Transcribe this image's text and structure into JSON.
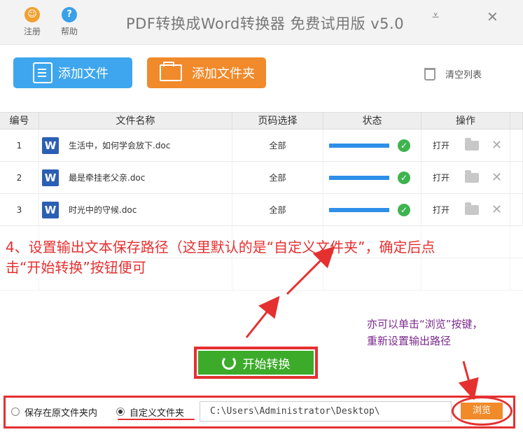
{
  "titlebar": {
    "register_label": "注册",
    "help_label": "帮助",
    "app_title": "PDF转换成Word转换器 免费试用版 v5.0",
    "minimize_glyph": "⩡",
    "close_glyph": "✕"
  },
  "toolbar": {
    "add_file_label": "添加文件",
    "add_folder_label": "添加文件夹",
    "clear_list_label": "清空列表"
  },
  "table": {
    "headers": [
      "编号",
      "文件名称",
      "页码选择",
      "状态",
      "操作"
    ],
    "rows": [
      {
        "no": "1",
        "name": "生活中，如何学会放下.doc",
        "pages": "全部",
        "progress": 1.0,
        "open": "打开"
      },
      {
        "no": "2",
        "name": "最是牵挂老父亲.doc",
        "pages": "全部",
        "progress": 1.0,
        "open": "打开"
      },
      {
        "no": "3",
        "name": "时光中的守候.doc",
        "pages": "全部",
        "progress": 1.0,
        "open": "打开"
      }
    ]
  },
  "annotations": {
    "main_line1": "4、设置输出文本保存路径（这里默认的是“自定义文件夹”，确定后点",
    "main_line2": "击“开始转换”按钮便可",
    "side_line1": "亦可以单击“浏览”按键，",
    "side_line2": "重新设置输出路径"
  },
  "start_button_label": "开始转换",
  "output": {
    "option_original": "保存在原文件夹内",
    "option_custom": "自定义文件夹",
    "selected": "custom",
    "path_value": "C:\\Users\\Administrator\\Desktop\\",
    "browse_label": "浏览"
  },
  "colors": {
    "add_file_button": "#3ea6ee",
    "add_folder_button": "#f08a2a",
    "start_button": "#3cab2a",
    "annotation_red": "#e53030",
    "annotation_purple": "#7b2a8c"
  }
}
